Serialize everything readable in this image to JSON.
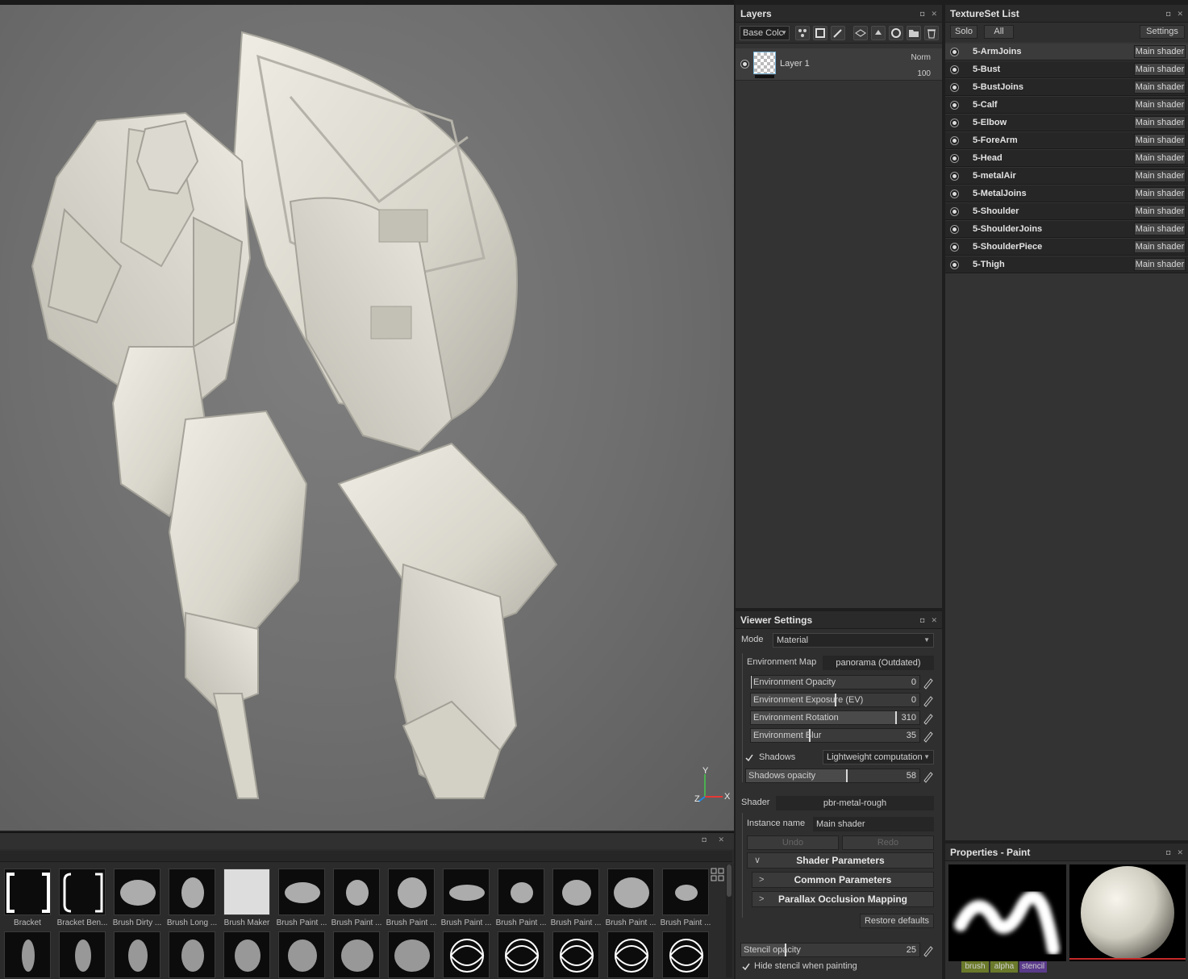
{
  "viewport": {
    "axis": {
      "y_label": "Y",
      "z_label": "Z",
      "x_label": "X"
    }
  },
  "shelf": {
    "row1": [
      {
        "label": "Bracket",
        "icon": "bracket-icon"
      },
      {
        "label": "Bracket Ben...",
        "icon": "bracket-bend-icon"
      },
      {
        "label": "Brush Dirty ...",
        "icon": "brush-dirty-icon"
      },
      {
        "label": "Brush Long ...",
        "icon": "brush-long-icon"
      },
      {
        "label": "Brush Maker",
        "icon": "brush-maker-icon"
      },
      {
        "label": "Brush Paint ...",
        "icon": "brush-paint-icon"
      },
      {
        "label": "Brush Paint ...",
        "icon": "brush-paint-icon"
      },
      {
        "label": "Brush Paint ...",
        "icon": "brush-paint-icon"
      },
      {
        "label": "Brush Paint ...",
        "icon": "brush-paint-icon"
      },
      {
        "label": "Brush Paint ...",
        "icon": "brush-paint-icon"
      },
      {
        "label": "Brush Paint ...",
        "icon": "brush-paint-icon"
      },
      {
        "label": "Brush Paint ...",
        "icon": "brush-paint-icon"
      },
      {
        "label": "Brush Paint ...",
        "icon": "brush-paint-icon"
      }
    ]
  },
  "layers": {
    "title": "Layers",
    "channel": "Base Colc",
    "layer": {
      "name": "Layer 1",
      "blend": "Norm",
      "opacity": "100"
    }
  },
  "viewer_settings": {
    "title": "Viewer Settings",
    "mode_label": "Mode",
    "mode_value": "Material",
    "env_map_label": "Environment Map",
    "env_map_value": "panorama (Outdated)",
    "sliders": [
      {
        "label": "Environment Opacity",
        "value": "0",
        "fraction": 0.0
      },
      {
        "label": "Environment Exposure (EV)",
        "value": "0",
        "fraction": 0.5
      },
      {
        "label": "Environment Rotation",
        "value": "310",
        "fraction": 0.86
      },
      {
        "label": "Environment Blur",
        "value": "35",
        "fraction": 0.35
      }
    ],
    "shadows_label": "Shadows",
    "shadows_checked": true,
    "shadows_mode": "Lightweight computation",
    "shadows_opacity_label": "Shadows opacity",
    "shadows_opacity_value": "58",
    "shadows_opacity_fraction": 0.58,
    "shader_label": "Shader",
    "shader_value": "pbr-metal-rough",
    "instance_label": "Instance name",
    "instance_value": "Main shader",
    "undo_label": "Undo",
    "redo_label": "Redo",
    "sections": [
      "Shader Parameters",
      "Common Parameters",
      "Parallax Occlusion Mapping"
    ],
    "restore_label": "Restore defaults",
    "stencil_label": "Stencil opacity",
    "stencil_value": "25",
    "stencil_fraction": 0.25,
    "hide_stencil_label": "Hide stencil when painting",
    "hide_stencil_checked": true
  },
  "textureset": {
    "title": "TextureSet List",
    "solo_label": "Solo",
    "all_label": "All",
    "settings_label": "Settings",
    "shader_label": "Main shader",
    "items": [
      "5-ArmJoins",
      "5-Bust",
      "5-BustJoins",
      "5-Calf",
      "5-Elbow",
      "5-ForeArm",
      "5-Head",
      "5-metalAir",
      "5-MetalJoins",
      "5-Shoulder",
      "5-ShoulderJoins",
      "5-ShoulderPiece",
      "5-Thigh"
    ]
  },
  "properties": {
    "title": "Properties - Paint",
    "tabs": [
      "brush",
      "alpha",
      "stencil"
    ],
    "tab_colors": [
      "#6a7a2a",
      "#6a7a2a",
      "#5a3a8a"
    ]
  },
  "colors": {
    "viewport_bg": "#6e6e6e",
    "model": "#e2e0d6",
    "panel_bg": "#2d2d2d",
    "accent_red": "#c62828"
  }
}
